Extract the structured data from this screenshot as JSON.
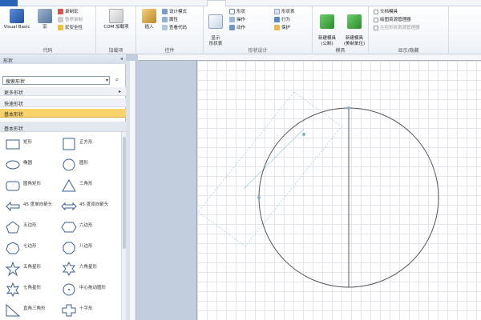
{
  "ribbon": {
    "groups": [
      {
        "label": "代码",
        "buttons": [
          "Visual Basic",
          "宏"
        ],
        "small": [
          "录制宏",
          "暂停录制",
          "宏安全性"
        ]
      },
      {
        "label": "加载项",
        "buttons": [
          "COM 加载项"
        ]
      },
      {
        "label": "控件",
        "buttons": [
          "插入"
        ],
        "small": [
          "设计模式",
          "属性",
          "查看代码"
        ]
      },
      {
        "label": "形状设计",
        "buttons": [
          "显示\n形状表"
        ],
        "small": [
          "形状",
          "操作",
          "动作",
          "形状表",
          "行为",
          "保护"
        ]
      },
      {
        "label": "模具",
        "buttons": [
          "新建模具\n(公制)",
          "新建模具\n(美制单位)"
        ]
      },
      {
        "label": "显示/隐藏",
        "checks": [
          "文档模具",
          "绘图资源管理器",
          "主控形状资源管理器"
        ]
      }
    ]
  },
  "panel": {
    "title": "形状",
    "search_placeholder": "搜索形状",
    "more_shapes": "更多形状",
    "quick_shapes": "快速形状",
    "basic_shapes_selected": "基本形状",
    "stencil_title": "基本形状",
    "shapes": [
      {
        "icon": "rectangle",
        "label": "矩形"
      },
      {
        "icon": "square",
        "label": "正方形"
      },
      {
        "icon": "ellipse",
        "label": "椭圆"
      },
      {
        "icon": "circle",
        "label": "圆形"
      },
      {
        "icon": "rounded-rectangle",
        "label": "圆角矩形"
      },
      {
        "icon": "triangle",
        "label": "三角形"
      },
      {
        "icon": "single-arrow",
        "label": "45 度单向箭头"
      },
      {
        "icon": "double-arrow",
        "label": "45 度双向箭头"
      },
      {
        "icon": "pentagon",
        "label": "五边形"
      },
      {
        "icon": "hexagon",
        "label": "六边形"
      },
      {
        "icon": "heptagon",
        "label": "七边形"
      },
      {
        "icon": "octagon",
        "label": "八边形"
      },
      {
        "icon": "star-5",
        "label": "五角星形"
      },
      {
        "icon": "star-6",
        "label": "六角星形"
      },
      {
        "icon": "star-7",
        "label": "七角星形"
      },
      {
        "icon": "center-drag-circle",
        "label": "中心拖动圆形"
      },
      {
        "icon": "right-triangle",
        "label": "直角三角形"
      },
      {
        "icon": "cross",
        "label": "十字形"
      }
    ]
  },
  "colors": {
    "ribbon_accent": "#2a63b8",
    "selected_category": "#f8d26a",
    "canvas_background": "#c2cddd",
    "shape_stroke": "#555555",
    "handle_color": "#7fb3c8"
  }
}
